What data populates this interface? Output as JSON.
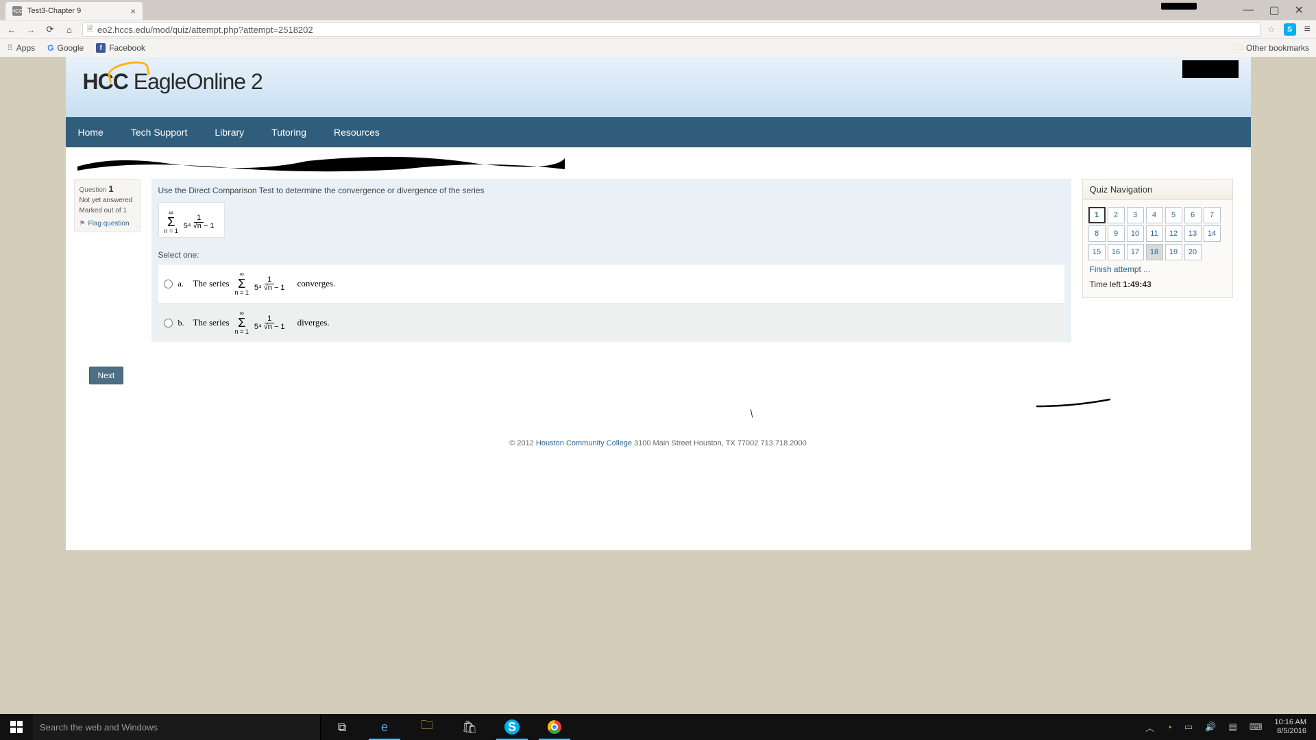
{
  "browser": {
    "tab_title": "Test3-Chapter 9",
    "favicon_text": "HCC",
    "url": "eo2.hccs.edu/mod/quiz/attempt.php?attempt=2518202",
    "bookmarks": {
      "apps": "Apps",
      "google": "Google",
      "facebook": "Facebook",
      "other": "Other bookmarks"
    }
  },
  "site": {
    "logo_html": "EagleOnline 2",
    "nav": [
      "Home",
      "Tech Support",
      "Library",
      "Tutoring",
      "Resources"
    ]
  },
  "question": {
    "info": {
      "label": "Question",
      "number": "1",
      "status": "Not yet answered",
      "marked": "Marked out of 1",
      "flag": "Flag question"
    },
    "prompt": "Use the Direct Comparison Test to determine the convergence or divergence of the series",
    "formula": {
      "sigma_top": "∞",
      "sigma_bottom": "n = 1",
      "numerator": "1",
      "denominator": "5⁴ √n − 1"
    },
    "select_one": "Select one:",
    "options": [
      {
        "letter": "a.",
        "prefix": "The series",
        "verdict": "converges."
      },
      {
        "letter": "b.",
        "prefix": "The series",
        "verdict": "diverges."
      }
    ],
    "next": "Next"
  },
  "quiznav": {
    "title": "Quiz Navigation",
    "cells": [
      "1",
      "2",
      "3",
      "4",
      "5",
      "6",
      "7",
      "8",
      "9",
      "10",
      "11",
      "12",
      "13",
      "14",
      "15",
      "16",
      "17",
      "18",
      "19",
      "20"
    ],
    "current": "1",
    "here": "18",
    "finish": "Finish attempt ...",
    "timeleft_label": "Time left ",
    "timeleft_value": "1:49:43"
  },
  "footer": {
    "copyright": "© 2012 ",
    "college": "Houston Community College",
    "rest": "   3100 Main Street Houston, TX 77002   713.718.2000"
  },
  "taskbar": {
    "search_placeholder": "Search the web and Windows",
    "time": "10:16 AM",
    "date": "8/5/2016"
  }
}
